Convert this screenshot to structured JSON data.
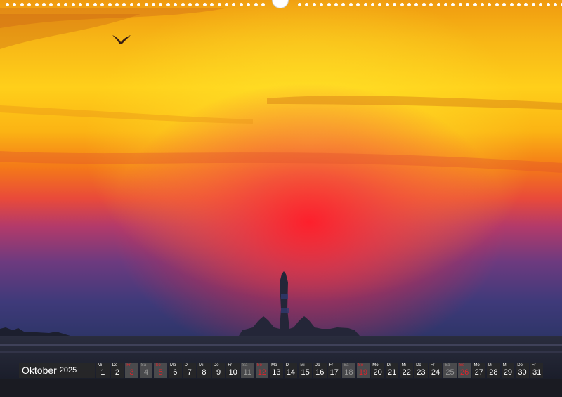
{
  "calendar": {
    "month": "Oktober",
    "year": "2025",
    "days": [
      {
        "wd": "Mi",
        "num": "1",
        "type": "weekday"
      },
      {
        "wd": "Do",
        "num": "2",
        "type": "weekday"
      },
      {
        "wd": "Fr",
        "num": "3",
        "type": "holiday"
      },
      {
        "wd": "Sa",
        "num": "4",
        "type": "saturday"
      },
      {
        "wd": "So",
        "num": "5",
        "type": "sunday"
      },
      {
        "wd": "Mo",
        "num": "6",
        "type": "weekday"
      },
      {
        "wd": "Di",
        "num": "7",
        "type": "weekday"
      },
      {
        "wd": "Mi",
        "num": "8",
        "type": "weekday"
      },
      {
        "wd": "Do",
        "num": "9",
        "type": "weekday"
      },
      {
        "wd": "Fr",
        "num": "10",
        "type": "weekday"
      },
      {
        "wd": "Sa",
        "num": "11",
        "type": "saturday"
      },
      {
        "wd": "So",
        "num": "12",
        "type": "sunday"
      },
      {
        "wd": "Mo",
        "num": "13",
        "type": "weekday"
      },
      {
        "wd": "Di",
        "num": "14",
        "type": "weekday"
      },
      {
        "wd": "Mi",
        "num": "15",
        "type": "weekday"
      },
      {
        "wd": "Do",
        "num": "16",
        "type": "weekday"
      },
      {
        "wd": "Fr",
        "num": "17",
        "type": "weekday"
      },
      {
        "wd": "Sa",
        "num": "18",
        "type": "saturday"
      },
      {
        "wd": "So",
        "num": "19",
        "type": "sunday"
      },
      {
        "wd": "Mo",
        "num": "20",
        "type": "weekday"
      },
      {
        "wd": "Di",
        "num": "21",
        "type": "weekday"
      },
      {
        "wd": "Mi",
        "num": "22",
        "type": "weekday"
      },
      {
        "wd": "Do",
        "num": "23",
        "type": "weekday"
      },
      {
        "wd": "Fr",
        "num": "24",
        "type": "weekday"
      },
      {
        "wd": "Sa",
        "num": "25",
        "type": "saturday"
      },
      {
        "wd": "So",
        "num": "26",
        "type": "sunday"
      },
      {
        "wd": "Mo",
        "num": "27",
        "type": "weekday"
      },
      {
        "wd": "Di",
        "num": "28",
        "type": "weekday"
      },
      {
        "wd": "Mi",
        "num": "29",
        "type": "weekday"
      },
      {
        "wd": "Do",
        "num": "30",
        "type": "weekday"
      },
      {
        "wd": "Fr",
        "num": "31",
        "type": "weekday"
      }
    ],
    "colors": {
      "sunday": "#e0242b",
      "bar": "#282828",
      "weekend_bg": "#555555"
    }
  },
  "photo": {
    "subject": "sunset-over-lighthouse",
    "icons": [
      "bird-icon",
      "lighthouse-icon"
    ]
  }
}
